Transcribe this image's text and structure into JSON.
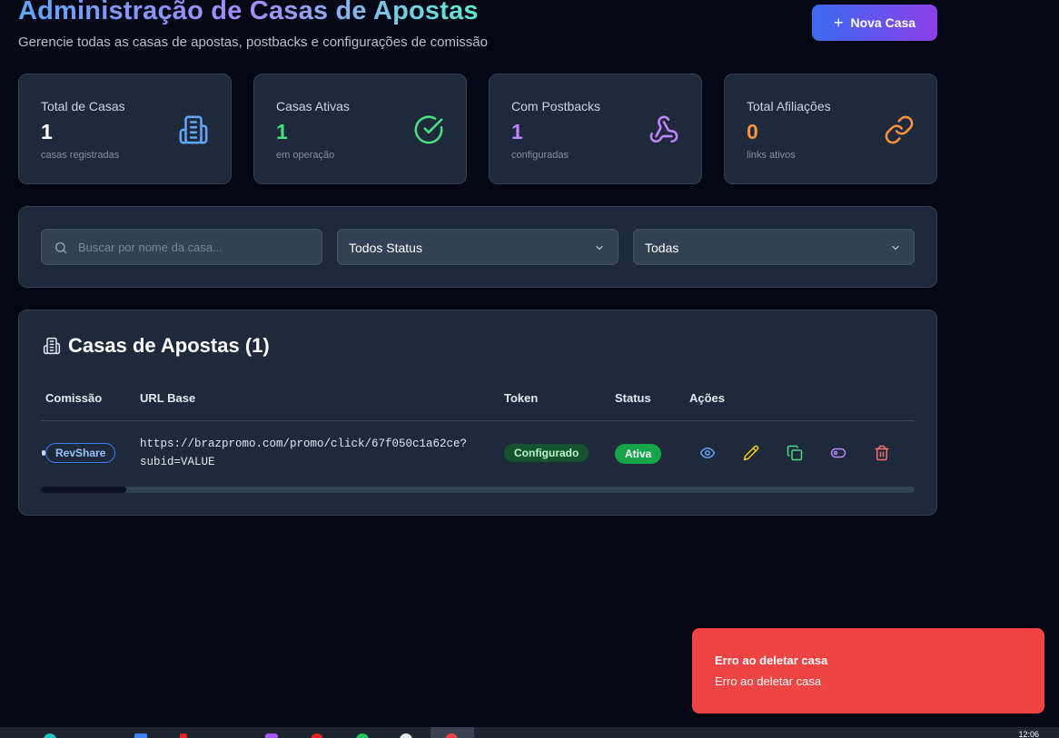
{
  "header": {
    "title": "Administração de Casas de Apostas",
    "subtitle": "Gerencie todas as casas de apostas, postbacks e configurações de comissão",
    "new_button": "Nova Casa",
    "new_button_icon": "plus-icon"
  },
  "stats": [
    {
      "label": "Total de Casas",
      "value": "1",
      "hint": "casas registradas",
      "icon": "building-icon",
      "color": "#60a5fa"
    },
    {
      "label": "Casas Ativas",
      "value": "1",
      "hint": "em operação",
      "icon": "check-circle-icon",
      "color": "#4ade80"
    },
    {
      "label": "Com Postbacks",
      "value": "1",
      "hint": "configuradas",
      "icon": "webhook-icon",
      "color": "#c084fc"
    },
    {
      "label": "Total Afiliações",
      "value": "0",
      "hint": "links ativos",
      "icon": "link-icon",
      "color": "#fb923c"
    }
  ],
  "filters": {
    "search_placeholder": "Buscar por nome da casa...",
    "status_select": "Todos Status",
    "type_select": "Todas"
  },
  "table": {
    "title": "Casas de Apostas (1)",
    "columns": [
      "Comissão",
      "URL Base",
      "Token",
      "Status",
      "Ações"
    ],
    "rows": [
      {
        "commission": "RevShare",
        "url_line1": "https://brazpromo.com/promo/click/67f050c1a62ce?",
        "url_line2": "subid=VALUE",
        "token": "Configurado",
        "status": "Ativa"
      }
    ],
    "actions": [
      "eye-icon",
      "pencil-icon",
      "copy-icon",
      "toggle-icon",
      "trash-icon"
    ]
  },
  "toast": {
    "title": "Erro ao deletar casa",
    "description": "Erro ao deletar casa"
  },
  "taskbar": {
    "time": "12:06"
  }
}
